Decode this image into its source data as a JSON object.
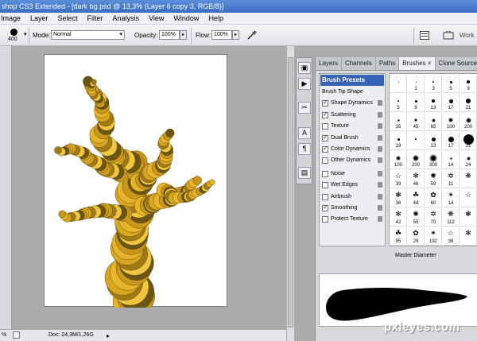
{
  "app": {
    "title": "shop CS3 Extended - [dark bg.psd @ 13,3% (Layer 6 copy 3, RGB/8)]"
  },
  "menu": [
    "Image",
    "Layer",
    "Select",
    "Filter",
    "Analysis",
    "View",
    "Window",
    "Help"
  ],
  "options": {
    "brush_size": "400",
    "mode_label": "Mode:",
    "mode_value": "Normal",
    "opacity_label": "Opacity:",
    "opacity_value": "100%",
    "flow_label": "Flow:",
    "flow_value": "100%",
    "workspace_label": "Work"
  },
  "status": {
    "zoom": "%",
    "doc": "Doc: 24,3M/1,26G"
  },
  "panel": {
    "tabs": [
      {
        "label": "Layers",
        "active": false
      },
      {
        "label": "Channels",
        "active": false
      },
      {
        "label": "Paths",
        "active": false
      },
      {
        "label": "Brushes ×",
        "active": true
      },
      {
        "label": "Clone Source",
        "active": false
      }
    ],
    "presets_label": "Brush Presets",
    "tip_shape_label": "Brush Tip Shape",
    "brush_options": [
      {
        "label": "Shape Dynamics",
        "checked": true
      },
      {
        "label": "Scattering",
        "checked": true
      },
      {
        "label": "Texture",
        "checked": false
      },
      {
        "label": "Dual Brush",
        "checked": true
      },
      {
        "label": "Color Dynamics",
        "checked": true
      },
      {
        "label": "Other Dynamics",
        "checked": false
      },
      {
        "label": "Noise",
        "checked": false
      },
      {
        "label": "Wet Edges",
        "checked": false
      },
      {
        "label": "Airbrush",
        "checked": false
      },
      {
        "label": "Smoothing",
        "checked": true
      },
      {
        "label": "Protect Texture",
        "checked": false
      }
    ],
    "master_diameter_label": "Master Diameter"
  },
  "brush_grid": {
    "rows": [
      [
        "",
        "1",
        "3",
        "5",
        "9"
      ],
      [
        "5",
        "9",
        "13",
        "17",
        "21"
      ],
      [
        "35",
        "45",
        "65",
        "100",
        "200"
      ],
      [
        "19",
        "",
        "13",
        "17",
        "21"
      ],
      [
        "100",
        "200",
        "300",
        "14",
        "24"
      ],
      [
        "39",
        "46",
        "59",
        "11",
        ""
      ],
      [
        "36",
        "44",
        "60",
        "14",
        ""
      ],
      [
        "42",
        "55",
        "70",
        "112",
        ""
      ],
      [
        "95",
        "29",
        "192",
        "36",
        ""
      ]
    ]
  },
  "watermark": "pxleyes.com"
}
